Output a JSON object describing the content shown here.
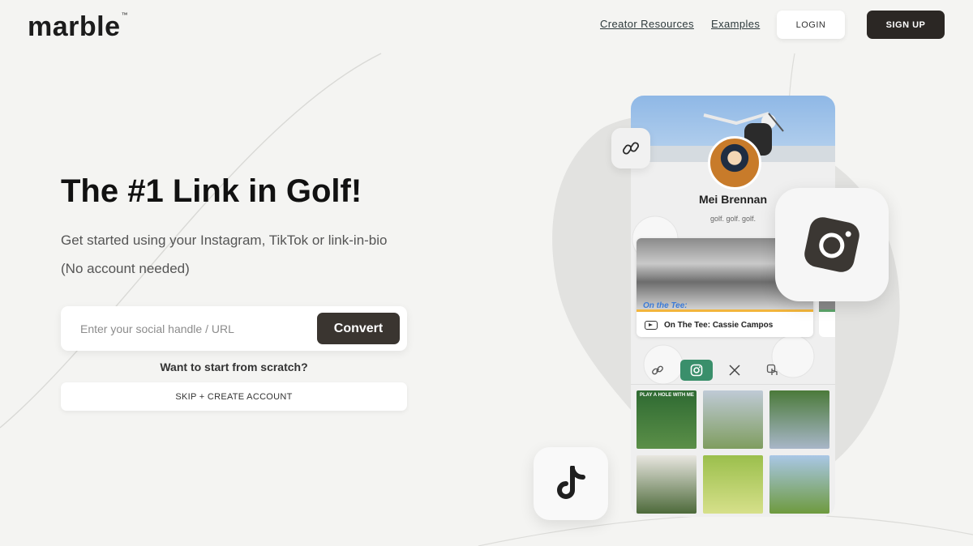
{
  "header": {
    "logo_text": "marble",
    "logo_tm": "™",
    "nav": {
      "creator_resources": "Creator Resources",
      "examples": "Examples",
      "login": "LOGIN",
      "signup": "SIGN UP"
    }
  },
  "hero": {
    "title": "The #1 Link in Golf!",
    "subtitle": "Get started using your Instagram, TikTok or link-in-bio",
    "subtitle_note": "(No account needed)",
    "input_placeholder": "Enter your social handle / URL",
    "input_value": "",
    "convert_label": "Convert",
    "scratch_question": "Want to start from scratch?",
    "skip_label": "SKIP + CREATE ACCOUNT"
  },
  "phone_preview": {
    "profile_name": "Mei Brennan",
    "profile_bio": "golf. golf. golf.",
    "video_tag": "On the Tee:",
    "video_title": "On The Tee: Cassie Campos",
    "tabs": [
      {
        "icon": "link-icon",
        "active": false
      },
      {
        "icon": "instagram-icon",
        "active": true
      },
      {
        "icon": "x-icon",
        "active": false
      },
      {
        "icon": "tap-icon",
        "active": false
      }
    ],
    "thumb_caption": "PLAY A HOLE WITH ME"
  },
  "floating_icons": [
    "link-icon",
    "instagram-icon",
    "tiktok-icon"
  ],
  "colors": {
    "background": "#f4f4f2",
    "primary_button": "#2b2724",
    "accent_green": "#3a8f6b",
    "text_dark": "#111111"
  }
}
